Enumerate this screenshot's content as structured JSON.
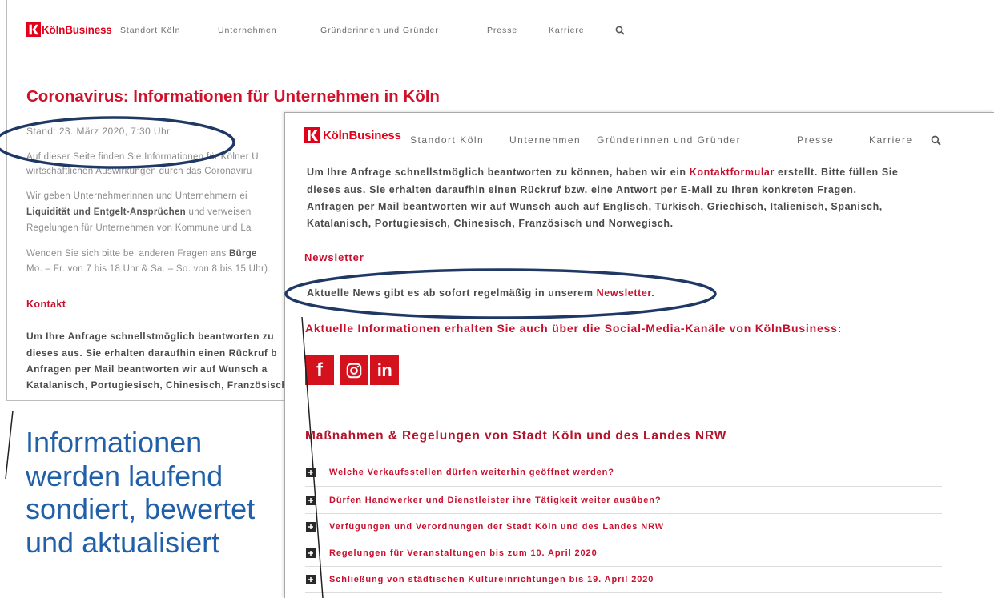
{
  "back_page": {
    "brand": "KölnBusiness",
    "nav": [
      "Standort Köln",
      "Unternehmen",
      "Gründerinnen und Gründer",
      "Presse",
      "Karriere"
    ],
    "title": "Coronavirus: Informationen für Unternehmen in Köln",
    "stand": "Stand: 23. März 2020, 7:30 Uhr",
    "intro_lines": [
      "Auf dieser Seite finden Sie Informationen für Kölner U",
      "wirtschaftlichen Auswirkungen durch das Coronaviru"
    ],
    "support": {
      "line1": "Wir geben Unternehmerinnen und Unternehmern ei",
      "line2_bold": "Liquidität und Entgelt-Ansprüchen",
      "line2_rest": " und verweisen",
      "line3": "Regelungen für Unternehmen von Kommune und La"
    },
    "hotline": {
      "line1_text": "Wenden Sie sich bitte bei anderen Fragen ans ",
      "line1_bold": "Bürge",
      "line2": "Mo. – Fr. von 7 bis 18 Uhr & Sa. – So. von 8 bis 15 Uhr)."
    },
    "kontakt_heading": "Kontakt",
    "kontakt_lines": [
      "Um Ihre Anfrage schnellstmöglich beantworten zu",
      "dieses aus. Sie erhalten daraufhin einen Rückruf b",
      "Anfragen per Mail beantworten wir auf Wunsch a",
      "Katalanisch, Portugiesisch, Chinesisch, Französisch"
    ]
  },
  "front_page": {
    "brand": "KölnBusiness",
    "nav": [
      "Standort Köln",
      "Unternehmen",
      "Gründerinnen und Gründer",
      "Presse",
      "Karriere"
    ],
    "kontakt": {
      "line1_text": "Um Ihre Anfrage schnellstmöglich beantworten zu können, haben wir ein ",
      "line1_link": "Kontaktformular",
      "line1_end": " erstellt. Bitte füllen Sie",
      "lines": [
        "dieses aus. Sie erhalten daraufhin einen Rückruf bzw. eine Antwort per E-Mail zu Ihren konkreten Fragen.",
        "Anfragen per Mail beantworten wir auf Wunsch auch auf Englisch, Türkisch, Griechisch, Italienisch, Spanisch,",
        "Katalanisch, Portugiesisch, Chinesisch, Französisch und Norwegisch."
      ]
    },
    "newsletter": {
      "heading": "Newsletter",
      "text": "Aktuelle News gibt es ab sofort regelmäßig in unserem ",
      "link": "Newsletter",
      "end": "."
    },
    "social": {
      "heading": "Aktuelle Informationen erhalten Sie auch über die Social-Media-Kanäle von KölnBusiness:",
      "icons": [
        {
          "name": "facebook-icon",
          "glyph": "f"
        },
        {
          "name": "instagram-icon"
        },
        {
          "name": "linkedin-icon",
          "glyph": "in"
        }
      ]
    },
    "measures": {
      "heading": "Maßnahmen & Regelungen von Stadt Köln und des Landes NRW",
      "items": [
        "Welche Verkaufsstellen dürfen weiterhin geöffnet werden?",
        "Dürfen Handwerker und Dienstleister ihre Tätigkeit weiter ausüben?",
        "Verfügungen und Verordnungen der Stadt Köln und des Landes NRW",
        "Regelungen für Veranstaltungen bis zum 10. April 2020",
        "Schließung von städtischen Kultureinrichtungen bis 19. April 2020"
      ]
    }
  },
  "annotation": {
    "caption_lines": [
      "Informationen",
      "werden laufend",
      "sondiert, bewertet",
      "und aktualisiert"
    ]
  },
  "icons": {
    "logo": "koelnbusiness-logo-icon",
    "search": "search-icon",
    "accordion": "plus-icon"
  },
  "colors": {
    "brand_red": "#e2001a",
    "heading_red": "#c8102e",
    "social_red": "#d4121e",
    "annotation_navy": "#1f3864",
    "caption_blue": "#2160a8"
  }
}
